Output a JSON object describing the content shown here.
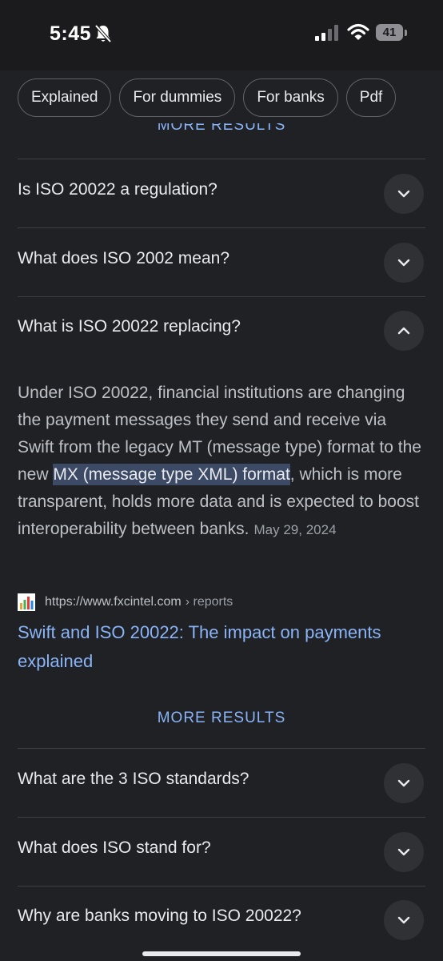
{
  "status_bar": {
    "time": "5:45",
    "battery": "41",
    "icons": [
      "bell-off-icon",
      "signal-icon",
      "wifi-icon",
      "battery-icon"
    ]
  },
  "chips": [
    "Explained",
    "For dummies",
    "For banks",
    "Pdf"
  ],
  "more_results_top": "MORE RESULTS",
  "faq_top": [
    {
      "question": "Is ISO 20022 a regulation?",
      "state": "collapsed"
    },
    {
      "question": "What does ISO 2002 mean?",
      "state": "collapsed"
    },
    {
      "question": "What is ISO 20022 replacing?",
      "state": "expanded"
    }
  ],
  "answer": {
    "text_before": "Under ISO 20022, financial institutions are changing the payment messages they send and receive via Swift from the legacy MT (message type) format to the new ",
    "highlight": "MX (message type XML) format",
    "text_after": ", which is more transparent, holds more data and is expected to boost interoperability between banks.",
    "date": "May 29, 2024"
  },
  "source": {
    "url": "https://www.fxcintel.com",
    "path": "› reports",
    "title": "Swift and ISO 20022: The impact on payments explained",
    "icon": "bar-chart-favicon-icon"
  },
  "more_results": "MORE RESULTS",
  "faq_bottom": [
    {
      "question": "What are the 3 ISO standards?",
      "state": "collapsed"
    },
    {
      "question": "What does ISO stand for?",
      "state": "collapsed"
    },
    {
      "question": "Why are banks moving to ISO 20022?",
      "state": "collapsed"
    }
  ],
  "colors": {
    "background": "#202124",
    "link": "#8ab4f8",
    "highlight": "#3c4a66"
  }
}
